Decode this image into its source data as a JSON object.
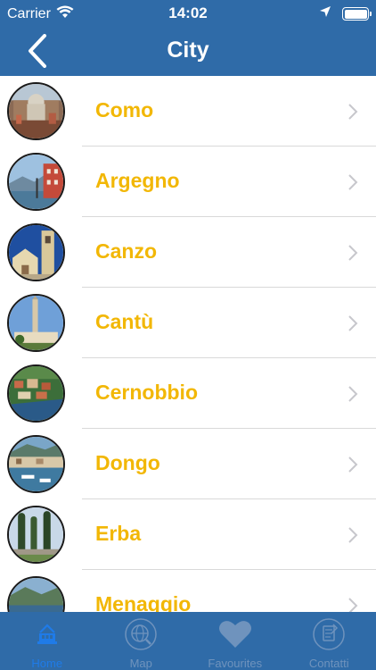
{
  "status_bar": {
    "carrier": "Carrier",
    "time": "14:02"
  },
  "nav": {
    "title": "City"
  },
  "cities": [
    {
      "name": "Como"
    },
    {
      "name": "Argegno"
    },
    {
      "name": "Canzo"
    },
    {
      "name": "Cantù"
    },
    {
      "name": "Cernobbio"
    },
    {
      "name": "Dongo"
    },
    {
      "name": "Erba"
    },
    {
      "name": "Menaggio"
    }
  ],
  "tabs": [
    {
      "label": "Home",
      "active": true
    },
    {
      "label": "Map",
      "active": false
    },
    {
      "label": "Favourites",
      "active": false
    },
    {
      "label": "Contatti",
      "active": false
    }
  ],
  "colors": {
    "bar_blue": "#2f6ba8",
    "city_label": "#f2b705",
    "tab_active": "#1f7be8",
    "tab_inactive": "#6f93bd"
  }
}
